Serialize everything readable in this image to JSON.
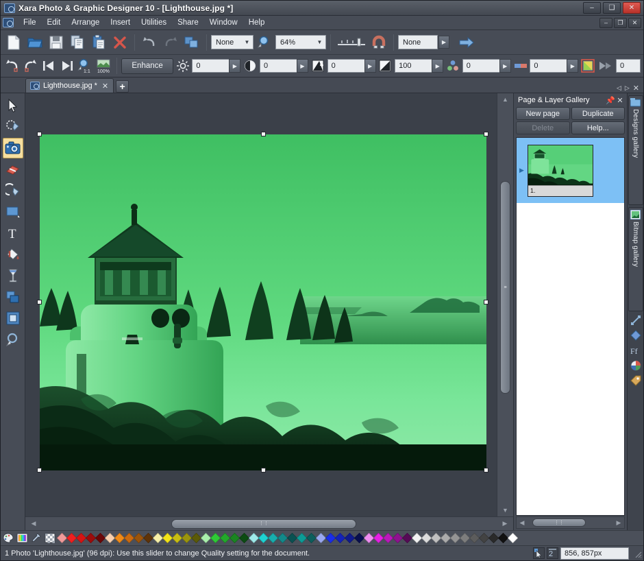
{
  "window": {
    "title": "Xara Photo & Graphic Designer 10 - [Lighthouse.jpg *]",
    "app_icon": "camera-icon",
    "minimize": "–",
    "maximize": "❑",
    "close": "✕",
    "doc_minimize": "–",
    "doc_restore": "❐",
    "doc_close": "✕"
  },
  "menubar": {
    "icon": "camera-icon",
    "items": [
      {
        "label": "File",
        "mnemonic": "F"
      },
      {
        "label": "Edit",
        "mnemonic": "E"
      },
      {
        "label": "Arrange",
        "mnemonic": "A"
      },
      {
        "label": "Insert",
        "mnemonic": "I"
      },
      {
        "label": "Utilities",
        "mnemonic": "U"
      },
      {
        "label": "Share",
        "mnemonic": "h"
      },
      {
        "label": "Window",
        "mnemonic": "W"
      },
      {
        "label": "Help",
        "mnemonic": "H"
      }
    ]
  },
  "toolbar_main": {
    "buttons": [
      {
        "name": "new-document-icon",
        "title": "New"
      },
      {
        "name": "open-document-icon",
        "title": "Open"
      },
      {
        "name": "save-document-icon",
        "title": "Save"
      },
      {
        "name": "copy-icon",
        "title": "Copy"
      },
      {
        "name": "paste-icon",
        "title": "Paste"
      },
      {
        "name": "delete-icon",
        "title": "Delete"
      },
      {
        "name": "undo-icon",
        "title": "Undo"
      },
      {
        "name": "redo-icon",
        "title": "Redo"
      },
      {
        "name": "duplicate-icon",
        "title": "Duplicate"
      }
    ],
    "page_select_value": "None",
    "zoom_icon": "zoom-icon",
    "zoom_value": "64%",
    "quality_slider_label": "quality-slider",
    "snap_icon": "magnet-icon",
    "layer_select_value": "None",
    "go_icon": "arrow-right-icon"
  },
  "toolbar_enhance": {
    "buttons": [
      {
        "name": "undo-icon"
      },
      {
        "name": "redo-icon"
      },
      {
        "name": "first-photo-icon"
      },
      {
        "name": "next-photo-icon"
      },
      {
        "name": "zoom-1to1-icon"
      },
      {
        "name": "zoom-100-icon"
      }
    ],
    "enhance_label": "Enhance",
    "fields": [
      {
        "name": "brightness",
        "icon": "brightness-icon",
        "value": "0"
      },
      {
        "name": "contrast",
        "icon": "contrast-icon",
        "value": "0"
      },
      {
        "name": "sharpen",
        "icon": "sharpen-icon",
        "value": "0"
      },
      {
        "name": "saturation",
        "icon": "saturation-icon",
        "value": "100"
      },
      {
        "name": "temperature",
        "icon": "color-balance-icon",
        "value": "0"
      },
      {
        "name": "tint",
        "icon": "tint-icon",
        "value": "0"
      }
    ],
    "color_picker_icon": "color-swatch-icon",
    "blur_icon": "blur-icon",
    "blur_value": "0"
  },
  "tabbar": {
    "tabs": [
      {
        "icon": "camera-icon",
        "label": "Lighthouse.jpg *",
        "close": "✕"
      }
    ],
    "add_tab": "+",
    "nav_prev": "◁",
    "nav_next": "▷",
    "nav_close": "✕"
  },
  "tools": [
    {
      "name": "selector-tool",
      "icon": "arrow-cursor-icon",
      "active": false
    },
    {
      "name": "shape-editor-tool",
      "icon": "shape-editor-icon",
      "active": false
    },
    {
      "name": "photo-tool",
      "icon": "camera-icon",
      "active": true
    },
    {
      "name": "eraser-tool",
      "icon": "eraser-icon",
      "active": false
    },
    {
      "name": "freehand-tool",
      "icon": "freehand-pen-icon",
      "active": false
    },
    {
      "name": "rectangle-tool",
      "icon": "rectangle-icon",
      "active": false
    },
    {
      "name": "text-tool",
      "icon": "text-t-icon",
      "active": false
    },
    {
      "name": "fill-tool",
      "icon": "fill-bucket-icon",
      "active": false
    },
    {
      "name": "transparency-tool",
      "icon": "goblet-icon",
      "active": false
    },
    {
      "name": "shadow-tool",
      "icon": "shadow-icon",
      "active": false
    },
    {
      "name": "bevel-tool",
      "icon": "bevel-frame-icon",
      "active": false
    },
    {
      "name": "zoom-tool",
      "icon": "magnifier-icon",
      "active": false
    }
  ],
  "canvas": {
    "document_name": "Lighthouse.jpg",
    "photo_alt": "lighthouse-photo-green-tint",
    "tint_color": "#3bbf5e",
    "selection_handles": 8
  },
  "panel": {
    "title": "Page & Layer Gallery",
    "pin_icon": "pin-icon",
    "close_icon": "close-icon",
    "buttons": [
      {
        "label": "New  page",
        "name": "new-page-button",
        "disabled": false
      },
      {
        "label": "Duplicate",
        "name": "duplicate-page-button",
        "disabled": false
      },
      {
        "label": "Delete",
        "name": "delete-page-button",
        "disabled": true
      },
      {
        "label": "Help...",
        "name": "help-button",
        "disabled": false
      }
    ],
    "pages": [
      {
        "number": "1.",
        "expander": "▶",
        "thumb": "lighthouse-thumbnail"
      }
    ]
  },
  "rail": {
    "tabs": [
      {
        "label": "Designs gallery",
        "icon": "designs-gallery-icon"
      },
      {
        "label": "Bitmap gallery",
        "icon": "bitmap-gallery-icon"
      }
    ],
    "icons": [
      {
        "name": "fill-gallery-icon"
      },
      {
        "name": "clipart-gallery-icon"
      },
      {
        "name": "font-gallery-icon"
      },
      {
        "name": "color-gallery-icon"
      },
      {
        "name": "name-gallery-icon"
      }
    ]
  },
  "palette": {
    "icons": [
      "palette-edit-icon",
      "color-editor-icon",
      "eyedropper-icon",
      "no-color-icon"
    ],
    "colors": [
      "#f09a9a",
      "#ef2020",
      "#d51414",
      "#9c0c0c",
      "#6b0707",
      "#f7cfae",
      "#ef8a18",
      "#c96a10",
      "#9a540c",
      "#5e3308",
      "#f7f0a8",
      "#f2e318",
      "#c8bd12",
      "#9a940d",
      "#5b5a08",
      "#a9efac",
      "#2fc936",
      "#23a82b",
      "#1b8422",
      "#0c4c13",
      "#9ee9e9",
      "#1fd2d2",
      "#18adad",
      "#13898a",
      "#0a5152",
      "#0d9b96",
      "#0c5e5c",
      "#9aa8f0",
      "#1a2ee8",
      "#1423b8",
      "#101b8c",
      "#080f4e",
      "#ee8ef0",
      "#e520e3",
      "#bb18bb",
      "#8f128f",
      "#560a56",
      "#f2f2f2",
      "#dcdcdc",
      "#c0c0c0",
      "#ababab",
      "#949494",
      "#7d7d7d",
      "#5c5c5c",
      "#434343",
      "#2a2a2a",
      "#111111",
      "#ffffff"
    ]
  },
  "statusbar": {
    "photo_count_prefix": "1 Photo",
    "message": "1 Photo 'Lighthouse.jpg' (96 dpi): Use this slider to change Quality setting for the document.",
    "cursor_icon": "cursor-icon",
    "layer_icon": "layer-2-icon",
    "coordinates": "856, 857px",
    "resize_grip": "resize-grip-icon"
  },
  "scrollbars": {
    "v_up": "▲",
    "v_down": "▼",
    "h_left": "◀",
    "h_right": "▶",
    "grip": "≡"
  }
}
